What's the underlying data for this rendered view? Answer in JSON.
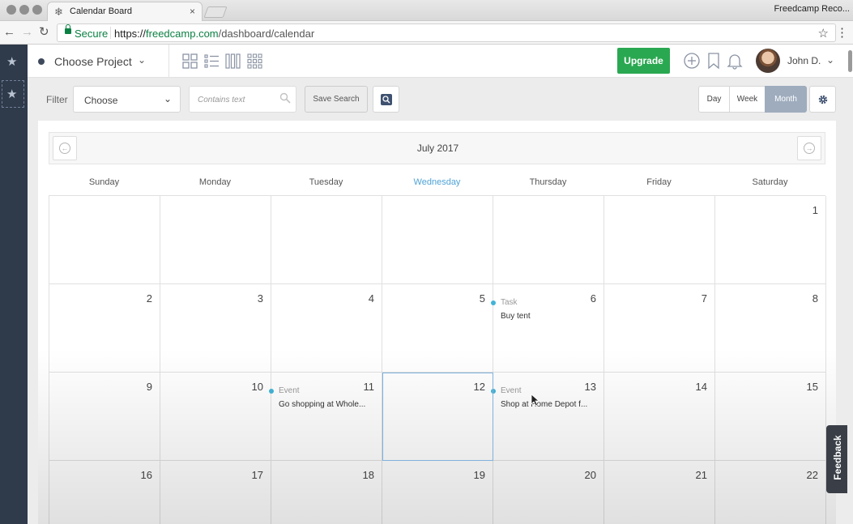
{
  "browser": {
    "tab_title": "Calendar Board",
    "tab_close": "×",
    "window_title": "Freedcamp Reco...",
    "secure_label": "Secure",
    "url_scheme": "https://",
    "url_domain": "freedcamp.com",
    "url_path": "/dashboard/calendar",
    "back": "←",
    "forward": "→",
    "reload": "↻",
    "bookmark": "☆",
    "menu": "⋮"
  },
  "sidebar": {
    "star": "★"
  },
  "header": {
    "project_label": "Choose Project",
    "caret": "⌄",
    "upgrade_label": "Upgrade",
    "user_name": "John D."
  },
  "toolbar": {
    "filter_label": "Filter",
    "filter_select": "Choose",
    "caret": "⌄",
    "search_placeholder": "Contains text",
    "save_search_label": "Save Search",
    "views": {
      "day": "Day",
      "week": "Week",
      "month": "Month"
    },
    "active_view": "Month"
  },
  "calendar": {
    "month_title": "July 2017",
    "prev": "←",
    "next": "→",
    "weekdays": [
      "Sunday",
      "Monday",
      "Tuesday",
      "Wednesday",
      "Thursday",
      "Friday",
      "Saturday"
    ],
    "today_weekday": "Wednesday",
    "weeks": [
      [
        "",
        "",
        "",
        "",
        "",
        "",
        "1"
      ],
      [
        "2",
        "3",
        "4",
        "5",
        "6",
        "7",
        "8"
      ],
      [
        "9",
        "10",
        "11",
        "12",
        "13",
        "14",
        "15"
      ],
      [
        "16",
        "17",
        "18",
        "19",
        "20",
        "21",
        "22"
      ]
    ],
    "selected_day": "12",
    "events": [
      {
        "day": "6",
        "type": "Task",
        "title": "Buy tent"
      },
      {
        "day": "11",
        "type": "Event",
        "title": "Go shopping at Whole..."
      },
      {
        "day": "13",
        "type": "Event",
        "title": "Shop at Home Depot f..."
      }
    ]
  },
  "feedback_label": "Feedback",
  "colors": {
    "accent_green": "#2aa851",
    "sidebar": "#2f3a4a",
    "today": "#4fa3d7",
    "event_dot": "#42b3d6",
    "active_view": "#9eacbe"
  }
}
